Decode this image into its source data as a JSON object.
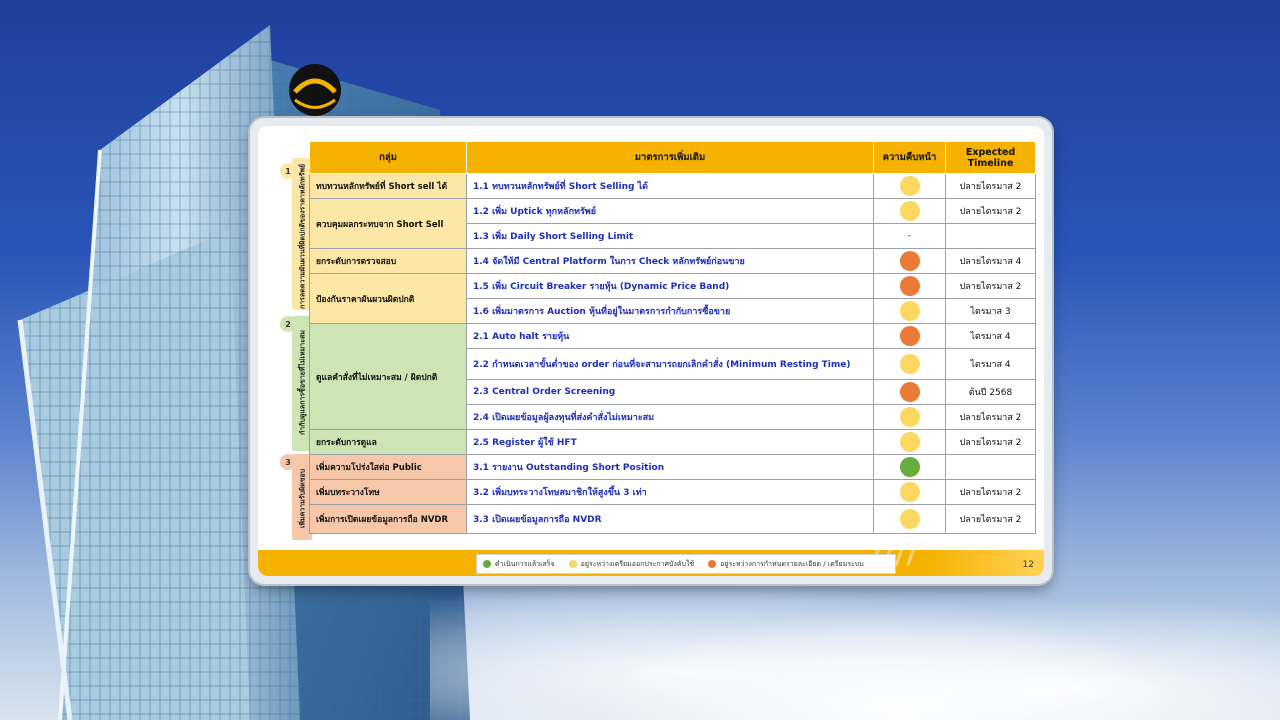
{
  "colors": {
    "done": "#6aab3d",
    "preparing": "#fbd862",
    "detailing": "#e97b37",
    "header": "#f5b200"
  },
  "table": {
    "headers": [
      "กลุ่ม",
      "มาตรการเพิ่มเติม",
      "ความคืบหน้า",
      "Expected Timeline"
    ],
    "groups": [
      {
        "number": "1",
        "label": "การลดความผันผวนที่ผิดปกติของราคาหลักทรัพย์"
      },
      {
        "number": "2",
        "label": "กำกับดูแลการซื้อขายที่ไม่เหมาะสม"
      },
      {
        "number": "3",
        "label": "เพิ่มความรับผิดชอบ"
      }
    ],
    "rows": [
      {
        "category": "ทบทวนหลักทรัพย์ที่ Short sell ได้",
        "measure": "1.1 ทบทวนหลักทรัพย์ที่ Short Selling ได้",
        "progress": "yellow",
        "timeline": "ปลายไตรมาส 2"
      },
      {
        "category": "ควบคุมผลกระทบจาก Short Sell",
        "measure": "1.2 เพิ่ม Uptick ทุกหลักทรัพย์",
        "progress": "yellow",
        "timeline": "ปลายไตรมาส 2"
      },
      {
        "category": "",
        "measure": "1.3 เพิ่ม Daily Short Selling Limit",
        "progress": "-",
        "timeline": ""
      },
      {
        "category": "ยกระดับการตรวจสอบ",
        "measure": "1.4 จัดให้มี Central Platform ในการ Check หลักทรัพย์ก่อนขาย",
        "progress": "orange",
        "timeline": "ปลายไตรมาส 4"
      },
      {
        "category": "ป้องกันราคาผันผวนผิดปกติ",
        "measure": "1.5 เพิ่ม Circuit Breaker รายหุ้น (Dynamic Price Band)",
        "progress": "orange",
        "timeline": "ปลายไตรมาส 2"
      },
      {
        "category": "",
        "measure": "1.6 เพิ่มมาตรการ Auction หุ้นที่อยู่ในมาตรการกำกับการซื้อขาย",
        "progress": "yellow",
        "timeline": "ไตรมาส 3"
      },
      {
        "category": "ดูแลคำสั่งที่ไม่เหมาะสม / ผิดปกติ",
        "measure": "2.1 Auto halt รายหุ้น",
        "progress": "orange",
        "timeline": "ไตรมาส 4"
      },
      {
        "category": "",
        "measure": "2.2 กำหนดเวลาขั้นต่ำของ order ก่อนที่จะสามารถยกเลิกคำสั่ง (Minimum Resting Time)",
        "progress": "yellow",
        "timeline": "ไตรมาส 4"
      },
      {
        "category": "",
        "measure": "2.3 Central Order Screening",
        "progress": "orange",
        "timeline": "ต้นปี 2568"
      },
      {
        "category": "",
        "measure": "2.4 เปิดเผยข้อมูลผู้ลงทุนที่ส่งคำสั่งไม่เหมาะสม",
        "progress": "yellow",
        "timeline": "ปลายไตรมาส 2"
      },
      {
        "category": "ยกระดับการดูแล",
        "measure": "2.5 Register ผู้ใช้ HFT",
        "progress": "yellow",
        "timeline": "ปลายไตรมาส 2"
      },
      {
        "category": "เพิ่มความโปร่งใสต่อ Public",
        "measure": "3.1 รายงาน Outstanding Short Position",
        "progress": "green",
        "timeline": ""
      },
      {
        "category": "เพิ่มบทระวางโทษ",
        "measure": "3.2 เพิ่มบทระวางโทษสมาชิกให้สูงขึ้น 3 เท่า",
        "progress": "yellow",
        "timeline": "ปลายไตรมาส 2"
      },
      {
        "category": "เพิ่มการเปิดเผยข้อมูลการถือ NVDR",
        "measure": "3.3 เปิดเผยข้อมูลการถือ NVDR",
        "progress": "yellow",
        "timeline": "ปลายไตรมาส 2"
      }
    ]
  },
  "legend": [
    {
      "label": "ดำเนินการแล้วเสร็จ",
      "color": "#6aab3d"
    },
    {
      "label": "อยู่ระหว่างเตรียมออกประกาศบังคับใช้",
      "color": "#fbd862"
    },
    {
      "label": "อยู่ระหว่างการกำหนดรายละเอียด / เตรียมระบบ",
      "color": "#e97b37"
    }
  ],
  "page_number": "12"
}
